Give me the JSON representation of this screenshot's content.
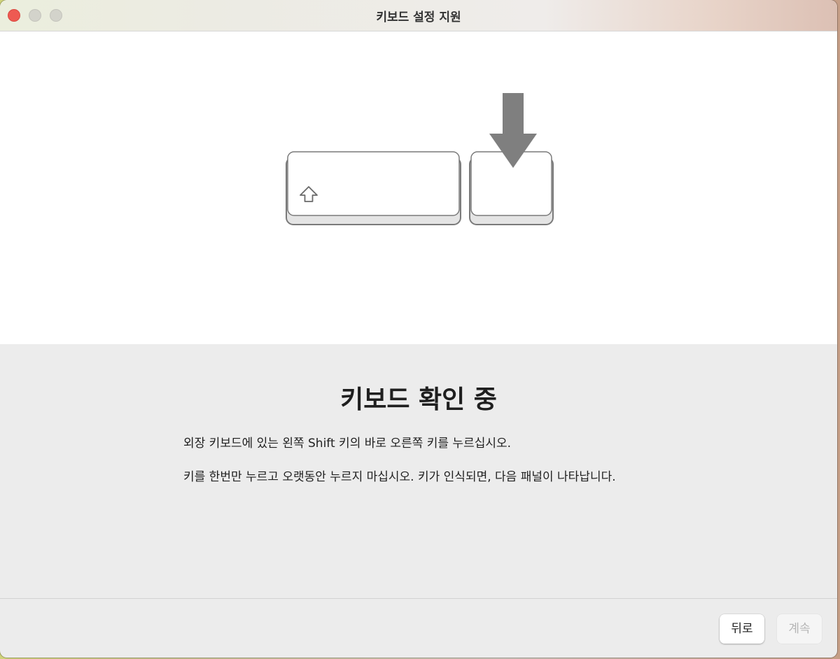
{
  "window": {
    "title": "키보드 설정 지원"
  },
  "icons": {
    "shift_key_glyph": "shift-arrow-icon",
    "press_indicator": "down-arrow-icon"
  },
  "main": {
    "heading": "키보드 확인 중",
    "paragraph_1": "외장 키보드에 있는 왼쪽 Shift 키의 바로 오른쪽 키를 누르십시오.",
    "paragraph_2": "키를 한번만 누르고 오랫동안 누르지 마십시오. 키가 인식되면, 다음 패널이 나타납니다."
  },
  "footer": {
    "back_label": "뒤로",
    "continue_label": "계속",
    "continue_enabled": false
  },
  "colors": {
    "close_button": "#ee5a52",
    "arrow": "#7f7f7f",
    "key_stroke": "#7a7a7a"
  }
}
